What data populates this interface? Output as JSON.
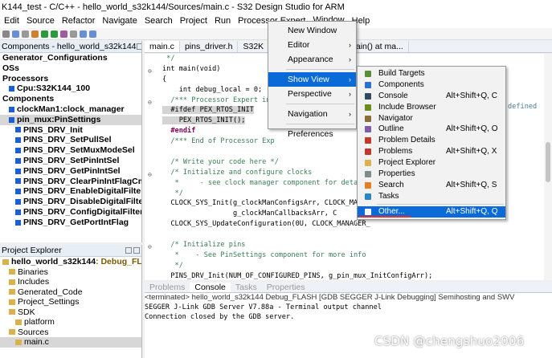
{
  "window_title": "K144_test - C/C++ - hello_world_s32k144/Sources/main.c - S32 Design Studio for ARM",
  "menubar": [
    "Edit",
    "Source",
    "Refactor",
    "Navigate",
    "Search",
    "Project",
    "Run",
    "Processor Expert",
    "Window",
    "Help"
  ],
  "components_panel": {
    "title": "Components - hello_world_s32k144",
    "items": [
      {
        "label": "Generator_Configurations",
        "indent": 0,
        "icon": false
      },
      {
        "label": "OSs",
        "indent": 0,
        "icon": false
      },
      {
        "label": "Processors",
        "indent": 0,
        "icon": false
      },
      {
        "label": "Cpu:S32K144_100",
        "indent": 1,
        "icon": true
      },
      {
        "label": "Components",
        "indent": 0,
        "icon": false
      },
      {
        "label": "clockMan1:clock_manager",
        "indent": 1,
        "icon": true
      },
      {
        "label": "pin_mux:PinSettings",
        "indent": 1,
        "icon": true,
        "selected": true
      },
      {
        "label": "PINS_DRV_Init",
        "indent": 2,
        "icon": true
      },
      {
        "label": "PINS_DRV_SetPullSel",
        "indent": 2,
        "icon": true
      },
      {
        "label": "PINS_DRV_SetMuxModeSel",
        "indent": 2,
        "icon": true
      },
      {
        "label": "PINS_DRV_SetPinIntSel",
        "indent": 2,
        "icon": true
      },
      {
        "label": "PINS_DRV_GetPinIntSel",
        "indent": 2,
        "icon": true
      },
      {
        "label": "PINS_DRV_ClearPinIntFlagCmd",
        "indent": 2,
        "icon": true
      },
      {
        "label": "PINS_DRV_EnableDigitalFilter",
        "indent": 2,
        "icon": true
      },
      {
        "label": "PINS_DRV_DisableDigitalFilter",
        "indent": 2,
        "icon": true
      },
      {
        "label": "PINS_DRV_ConfigDigitalFilter",
        "indent": 2,
        "icon": true
      },
      {
        "label": "PINS_DRV_GetPortIntFlag",
        "indent": 2,
        "icon": true
      }
    ]
  },
  "project_explorer": {
    "title": "Project Explorer",
    "items": [
      {
        "label": "hello_world_s32k144",
        "suffix": ": Debug_FLASH",
        "indent": 0
      },
      {
        "label": "Binaries",
        "indent": 1
      },
      {
        "label": "Includes",
        "indent": 1
      },
      {
        "label": "Generated_Code",
        "indent": 1
      },
      {
        "label": "Project_Settings",
        "indent": 1
      },
      {
        "label": "SDK",
        "indent": 1
      },
      {
        "label": "platform",
        "indent": 2
      },
      {
        "label": "Sources",
        "indent": 1
      },
      {
        "label": "main.c",
        "indent": 2,
        "selected": true
      }
    ]
  },
  "editor_tabs": [
    "main.c",
    "pins_driver.h",
    "S32K",
    "clock_S32K1xx.c",
    "main() at ma..."
  ],
  "code_lines": [
    {
      "text": " */",
      "cls": "c-comment"
    },
    {
      "text": "int main(void)",
      "cls": "",
      "marker": "⊖"
    },
    {
      "text": "{",
      "cls": ""
    },
    {
      "text": "    int debug_local = 0;",
      "cls": ""
    },
    {
      "text": "  /*** Processor Expert int",
      "cls": "c-comment",
      "marker": "⊖"
    },
    {
      "text": "  #ifdef PEX_RTOS_INIT",
      "cls": "c-hl"
    },
    {
      "text": "    PEX_RTOS_INIT();",
      "cls": "c-hl"
    },
    {
      "text": "  #endif",
      "cls": "c-kw"
    },
    {
      "text": "  /*** End of Processor Exp",
      "cls": "c-comment"
    },
    {
      "text": "",
      "cls": ""
    },
    {
      "text": "  /* Write your code here */",
      "cls": "c-comment"
    },
    {
      "text": "  /* Initialize and configure clocks",
      "cls": "c-comment",
      "marker": "⊖"
    },
    {
      "text": "   *     - see clock manager component for detai",
      "cls": "c-comment"
    },
    {
      "text": "   */",
      "cls": "c-comment"
    },
    {
      "text": "  CLOCK_SYS_Init(g_clockManConfigsArr, CLOCK_MANAG",
      "cls": ""
    },
    {
      "text": "                 g_clockManCallbacksArr, C",
      "cls": ""
    },
    {
      "text": "  CLOCK_SYS_UpdateConfiguration(0U, CLOCK_MANAGER_",
      "cls": ""
    },
    {
      "text": "",
      "cls": ""
    },
    {
      "text": "  /* Initialize pins",
      "cls": "c-comment",
      "marker": "⊖"
    },
    {
      "text": "   *    - See PinSettings component for more info",
      "cls": "c-comment"
    },
    {
      "text": "   */",
      "cls": "c-comment"
    },
    {
      "text": "  PINS_DRV_Init(NUM_OF_CONFIGURED_PINS, g_pin_mux_InitConfigArr);",
      "cls": ""
    },
    {
      "text": "",
      "cls": ""
    },
    {
      "text": "  /* Output direction for LED0 & LED1 */",
      "cls": "c-comment"
    },
    {
      "text": "  //PINS_DRV_SetPinsDirection(GPIO_PORT, ((1 << LED1) | (1 << LED2)));",
      "cls": "c-comment"
    }
  ],
  "defined_text": "defined",
  "console_tabs": [
    "Problems",
    "Console",
    "Tasks",
    "Properties"
  ],
  "console_lines": [
    "<terminated> hello_world_s32k144 Debug_FLASH [GDB SEGGER J-Link Debugging] Semihosting and SWV",
    "SEGGER J-Link GDB Server V7.88a - Terminal output channel",
    "Connection closed by the GDB server."
  ],
  "window_menu": [
    {
      "label": "New Window"
    },
    {
      "label": "Editor",
      "submenu": true
    },
    {
      "label": "Appearance",
      "submenu": true
    },
    {
      "sep": true
    },
    {
      "label": "Show View",
      "submenu": true,
      "highlighted": true
    },
    {
      "label": "Perspective",
      "submenu": true
    },
    {
      "sep": true
    },
    {
      "label": "Navigation",
      "submenu": true
    },
    {
      "sep": true
    },
    {
      "label": "Preferences"
    }
  ],
  "show_view_menu": [
    {
      "label": "Build Targets",
      "shortcut": "",
      "icon_color": "#5a8f3a"
    },
    {
      "label": "Components",
      "shortcut": "",
      "icon_color": "#2f6fd0"
    },
    {
      "label": "Console",
      "shortcut": "Alt+Shift+Q, C",
      "icon_color": "#34495e"
    },
    {
      "label": "Include Browser",
      "shortcut": "",
      "icon_color": "#6b8e23"
    },
    {
      "label": "Navigator",
      "shortcut": "",
      "icon_color": "#8a6d3b"
    },
    {
      "label": "Outline",
      "shortcut": "Alt+Shift+Q, O",
      "icon_color": "#7b5ea7"
    },
    {
      "label": "Problem Details",
      "shortcut": "",
      "icon_color": "#c0392b"
    },
    {
      "label": "Problems",
      "shortcut": "Alt+Shift+Q, X",
      "icon_color": "#c0392b"
    },
    {
      "label": "Project Explorer",
      "shortcut": "",
      "icon_color": "#d9b24c"
    },
    {
      "label": "Properties",
      "shortcut": "",
      "icon_color": "#7f8c8d"
    },
    {
      "label": "Search",
      "shortcut": "Alt+Shift+Q, S",
      "icon_color": "#e67e22"
    },
    {
      "label": "Tasks",
      "shortcut": "",
      "icon_color": "#2e86c1"
    },
    {
      "sep": true
    },
    {
      "label": "Other...",
      "shortcut": "Alt+Shift+Q, Q",
      "icon_color": "#ffffff",
      "highlighted": true
    }
  ],
  "watermark": "CSDN @chengshuo2006"
}
